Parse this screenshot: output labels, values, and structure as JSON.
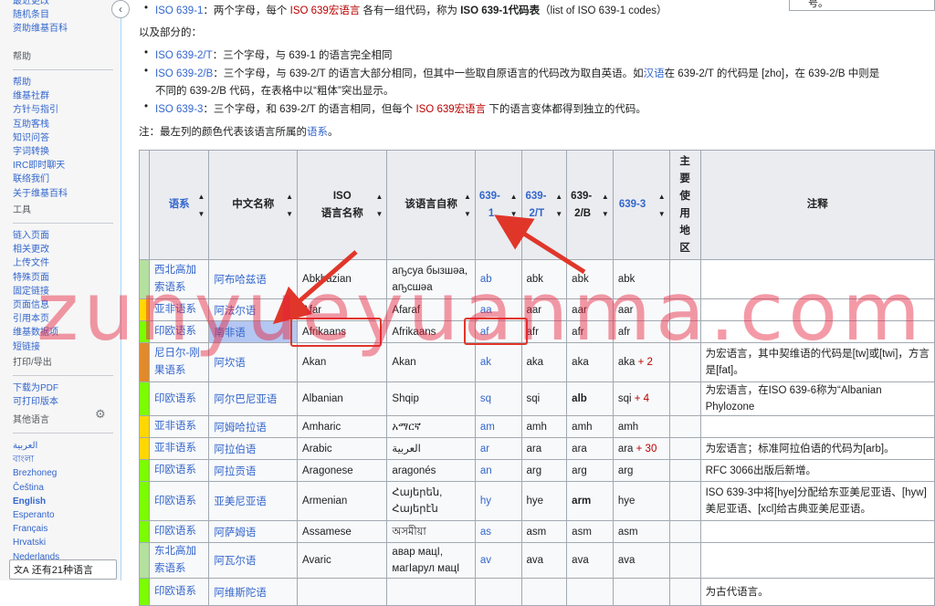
{
  "sidebar": {
    "top_items": [
      "最近更改",
      "随机条目",
      "资助维基百科"
    ],
    "help": {
      "heading": "帮助",
      "items": [
        "帮助",
        "维基社群",
        "方针与指引",
        "互助客栈",
        "知识问答",
        "字词转换",
        "IRC即时聊天",
        "联络我们",
        "关于维基百科"
      ]
    },
    "tools": {
      "heading": "工具",
      "items": [
        "链入页面",
        "相关更改",
        "上传文件",
        "特殊页面",
        "固定链接",
        "页面信息",
        "引用本页",
        "维基数据项",
        "短链接"
      ]
    },
    "print": {
      "heading": "打印/导出",
      "items": [
        "下载为PDF",
        "可打印版本"
      ]
    },
    "langs": {
      "heading": "其他语言",
      "items": [
        "العربية",
        "বাংলা",
        "Brezhoneg",
        "Čeština",
        "English",
        "Esperanto",
        "Français",
        "Hrvatski",
        "Nederlands"
      ],
      "more": "还有21种语言"
    }
  },
  "tooltip": "号。",
  "intro": {
    "line1": {
      "link": "ISO 639-1",
      "text1": "：两个字母，每个 ",
      "macro": "ISO 639宏语言",
      "text2": " 各有一组代码，称为 ",
      "bold": "ISO 639-1代码表",
      "text3": "（list of ISO 639-1 codes）"
    },
    "also": "以及部分的：",
    "line2": {
      "link": "ISO 639-2/T",
      "text": "：三个字母，与 639-1 的语言完全相同"
    },
    "line3": {
      "link": "ISO 639-2/B",
      "text1": "：三个字母，与 639-2/T 的语言大部分相同，但其中一些取自原语言的代码改为取自英语。如",
      "zh": "汉语",
      "text2": "在 639-2/T 的代码是 [zho]，在 639-2/B 中则是"
    },
    "line3b": "不同的 639-2/B 代码，在表格中以“粗体”突出显示。",
    "line4": {
      "link": "ISO 639-3",
      "text1": "：三个字母，和 639-2/T 的语言相同，但每个 ",
      "macro": "ISO 639宏语言",
      "text2": " 下的语言变体都得到独立的代码。"
    },
    "note": {
      "text": "注：最左列的颜色代表该语言所属的",
      "link": "语系",
      "end": "。"
    }
  },
  "table": {
    "headers": {
      "family": "语系",
      "zh": "中文名称",
      "iso_a": "ISO",
      "iso_b": "语言名称",
      "native": "该语言自称",
      "c1a": "639-",
      "c1b": "1",
      "c2a": "639-",
      "c2b": "2/T",
      "c3a": "639-",
      "c3b": "2/B",
      "c4": "639-3",
      "main": "主要使用地区",
      "notes": "注释"
    },
    "rows": [
      {
        "color": "#b4e0a0",
        "family": "西北高加索语系",
        "zh": "阿布哈兹语",
        "iso": "Abkhazian",
        "native": "аҧсуа бызшәа, аҧсшәа",
        "c1": "ab",
        "c2": "abk",
        "c3": "abk",
        "c3bold": false,
        "c4": "abk",
        "extra": "",
        "notes": ""
      },
      {
        "color": "#ffd700",
        "family": "亚非语系",
        "zh": "阿法尔语",
        "iso": "Afar",
        "native": "Afaraf",
        "c1": "aa",
        "c2": "aar",
        "c3": "aar",
        "c3bold": false,
        "c4": "aar",
        "extra": "",
        "notes": ""
      },
      {
        "color": "#7cfc00",
        "family": "印欧语系",
        "zh": "南非语",
        "iso": "Afrikaans",
        "native": "Afrikaans",
        "c1": "af",
        "c2": "afr",
        "c3": "afr",
        "c3bold": false,
        "c4": "afr",
        "extra": "",
        "notes": ""
      },
      {
        "color": "#e08a2c",
        "family": "尼日尔-刚果语系",
        "zh": "阿坎语",
        "iso": "Akan",
        "native": "Akan",
        "c1": "ak",
        "c2": "aka",
        "c3": "aka",
        "c3bold": false,
        "c4": "aka",
        "extra": " + 2",
        "notes": "为宏语言，其中契维语的代码是[tw]或[twi]，方言是[fat]。"
      },
      {
        "color": "#7cfc00",
        "family": "印欧语系",
        "zh": "阿尔巴尼亚语",
        "iso": "Albanian",
        "native": "Shqip",
        "c1": "sq",
        "c2": "sqi",
        "c3": "alb",
        "c3bold": true,
        "c4": "sqi",
        "extra": " + 4",
        "notes": "为宏语言，在ISO 639-6称为“Albanian Phylozone"
      },
      {
        "color": "#ffd700",
        "family": "亚非语系",
        "zh": "阿姆哈拉语",
        "iso": "Amharic",
        "native": "አማርኛ",
        "c1": "am",
        "c2": "amh",
        "c3": "amh",
        "c3bold": false,
        "c4": "amh",
        "extra": "",
        "notes": ""
      },
      {
        "color": "#ffd700",
        "family": "亚非语系",
        "zh": "阿拉伯语",
        "iso": "Arabic",
        "native": "العربية",
        "c1": "ar",
        "c2": "ara",
        "c3": "ara",
        "c3bold": false,
        "c4": "ara",
        "extra": " + 30",
        "notes": "为宏语言；标准阿拉伯语的代码为[arb]。"
      },
      {
        "color": "#7cfc00",
        "family": "印欧语系",
        "zh": "阿拉贡语",
        "iso": "Aragonese",
        "native": "aragonés",
        "c1": "an",
        "c2": "arg",
        "c3": "arg",
        "c3bold": false,
        "c4": "arg",
        "extra": "",
        "notes": "RFC 3066出版后新增。"
      },
      {
        "color": "#7cfc00",
        "family": "印欧语系",
        "zh": "亚美尼亚语",
        "iso": "Armenian",
        "native": "Հայերեն, Հայերէն",
        "c1": "hy",
        "c2": "hye",
        "c3": "arm",
        "c3bold": true,
        "c4": "hye",
        "extra": "",
        "notes": "ISO 639-3中将[hye]分配给东亚美尼亚语、[hyw]美尼亚语、[xcl]给古典亚美尼亚语。"
      },
      {
        "color": "#7cfc00",
        "family": "印欧语系",
        "zh": "阿萨姆语",
        "iso": "Assamese",
        "native": "অসমীয়া",
        "c1": "as",
        "c2": "asm",
        "c3": "asm",
        "c3bold": false,
        "c4": "asm",
        "extra": "",
        "notes": ""
      },
      {
        "color": "#b4e0a0",
        "family": "东北高加索语系",
        "zh": "阿瓦尔语",
        "iso": "Avaric",
        "native": "авар мацӀ, магӀарул мацӀ",
        "c1": "av",
        "c2": "ava",
        "c3": "ava",
        "c3bold": false,
        "c4": "ava",
        "extra": "",
        "notes": ""
      },
      {
        "color": "#7cfc00",
        "family": "印欧语系",
        "zh": "阿维斯陀语",
        "iso": "",
        "native": "",
        "c1": "",
        "c2": "",
        "c3": "",
        "c3bold": false,
        "c4": "",
        "extra": "",
        "notes": "为古代语言。"
      }
    ]
  },
  "watermark": "zunyueyuanma.com",
  "colors": {
    "link": "#3366cc",
    "redlink": "#ba0000",
    "annotation": "#e0362a"
  }
}
